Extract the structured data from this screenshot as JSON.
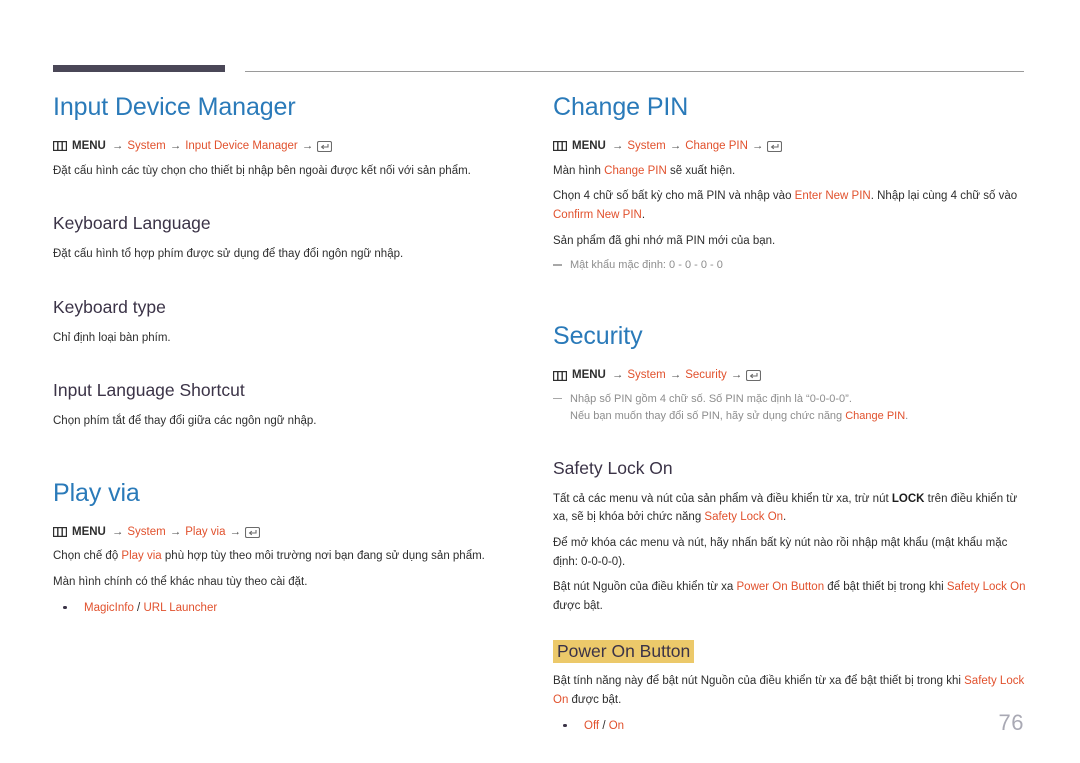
{
  "page": {
    "number": "76"
  },
  "icons": {
    "menu": "menu-grid-icon",
    "enter": "enter-key-icon"
  },
  "labels": {
    "menu_word": "MENU",
    "arrow": "→",
    "slash": " / "
  },
  "left_column": [
    {
      "type": "section",
      "title": "Input Device Manager",
      "menu_path": [
        "System",
        "Input Device Manager"
      ],
      "paragraphs": [
        "Đặt cấu hình các tùy chọn cho thiết bị nhập bên ngoài được kết nối với sản phẩm."
      ],
      "subsections": [
        {
          "title": "Keyboard Language",
          "paragraphs": [
            "Đặt cấu hình tổ hợp phím được sử dụng để thay đổi ngôn ngữ nhập."
          ]
        },
        {
          "title": "Keyboard type",
          "paragraphs": [
            "Chỉ định loại bàn phím."
          ]
        },
        {
          "title": "Input Language Shortcut",
          "paragraphs": [
            "Chọn phím tắt để thay đổi giữa các ngôn ngữ nhập."
          ]
        }
      ]
    },
    {
      "type": "section",
      "title": "Play via",
      "menu_path": [
        "System",
        "Play via"
      ],
      "paragraphs": [
        "Chọn chế độ Play via phù hợp tùy theo môi trường nơi bạn đang sử dụng sản phẩm.",
        "Màn hình chính có thể khác nhau tùy theo cài đặt."
      ],
      "bullets": [
        {
          "options": [
            "MagicInfo",
            "URL Launcher"
          ]
        }
      ]
    }
  ],
  "right_column": [
    {
      "type": "section",
      "title": "Change PIN",
      "menu_path": [
        "System",
        "Change PIN"
      ],
      "paragraphs": [
        "Màn hình Change PIN sẽ xuất hiện.",
        "Chọn 4 chữ số bất kỳ cho mã PIN và nhập vào Enter New PIN. Nhập lại cùng 4 chữ số vào Confirm New PIN.",
        "Sản phẩm đã ghi nhớ mã PIN mới của bạn."
      ],
      "notes": [
        "Mật khẩu mặc định: 0 - 0 - 0 - 0"
      ]
    },
    {
      "type": "section",
      "title": "Security",
      "menu_path": [
        "System",
        "Security"
      ],
      "notes": [
        "Nhập số PIN gồm 4 chữ số. Số PIN mặc định là “0-0-0-0”.",
        "Nếu bạn muốn thay đổi số PIN, hãy sử dụng chức năng Change PIN."
      ],
      "subsections": [
        {
          "title": "Safety Lock On",
          "paragraphs": [
            "Tất cả các menu và nút của sản phẩm và điều khiển từ xa, trừ nút LOCK trên điều khiển từ xa, sẽ bị khóa bởi chức năng Safety Lock On.",
            "Để mở khóa các menu và nút, hãy nhấn bất kỳ nút nào rồi nhập mật khẩu (mật khẩu mặc định: 0-0-0-0).",
            "Bật nút Nguồn của điều khiển từ xa Power On Button để bật thiết bị trong khi Safety Lock On được bật."
          ]
        },
        {
          "title": "Power On Button",
          "highlighted": true,
          "paragraphs": [
            "Bật tính năng này để bật nút Nguồn của điều khiển từ xa để bật thiết bị trong khi Safety Lock On được bật."
          ],
          "bullets": [
            {
              "options": [
                "Off",
                "On"
              ]
            }
          ]
        }
      ]
    }
  ],
  "text_fragments": {
    "idm_body": "Đặt cấu hình các tùy chọn cho thiết bị nhập bên ngoài được kết nối với sản phẩm.",
    "kb_lang_title": "Keyboard Language",
    "kb_lang_body": "Đặt cấu hình tổ hợp phím được sử dụng để thay đổi ngôn ngữ nhập.",
    "kb_type_title": "Keyboard type",
    "kb_type_body": "Chỉ định loại bàn phím.",
    "ils_title": "Input Language Shortcut",
    "ils_body": "Chọn phím tắt để thay đổi giữa các ngôn ngữ nhập.",
    "playvia_title": "Play via",
    "playvia_p1_a": "Chọn chế độ ",
    "playvia_p1_accent": "Play via",
    "playvia_p1_b": " phù hợp tùy theo môi trường nơi bạn đang sử dụng sản phẩm.",
    "playvia_p2": "Màn hình chính có thể khác nhau tùy theo cài đặt.",
    "playvia_opt1": "MagicInfo",
    "playvia_opt2": "URL Launcher",
    "changepin_title": "Change PIN",
    "changepin_p1_a": "Màn hình ",
    "changepin_p1_accent": "Change PIN",
    "changepin_p1_b": " sẽ xuất hiện.",
    "changepin_p2_a": "Chọn 4 chữ số bất kỳ cho mã PIN và nhập vào ",
    "changepin_p2_accent1": "Enter New PIN",
    "changepin_p2_b": ". Nhập lại cùng 4 chữ số vào ",
    "changepin_p2_accent2": "Confirm New PIN",
    "changepin_p2_c": ".",
    "changepin_p3": "Sản phẩm đã ghi nhớ mã PIN mới của bạn.",
    "changepin_note": "Mật khẩu mặc định: 0 - 0 - 0 - 0",
    "security_title": "Security",
    "security_note1": "Nhập số PIN gồm 4 chữ số. Số PIN mặc định là “0-0-0-0”.",
    "security_note2_a": "Nếu bạn muốn thay đổi số PIN, hãy sử dụng chức năng ",
    "security_note2_accent": "Change PIN",
    "security_note2_b": ".",
    "safety_title": "Safety Lock On",
    "safety_p1_a": "Tất cả các menu và nút của sản phẩm và điều khiển từ xa, trừ nút ",
    "safety_p1_bold": "LOCK",
    "safety_p1_b": " trên điều khiển từ xa, sẽ bị khóa bởi chức năng ",
    "safety_p1_accent": "Safety Lock On",
    "safety_p1_c": ".",
    "safety_p2": "Để mở khóa các menu và nút, hãy nhấn bất kỳ nút nào rồi nhập mật khẩu (mật khẩu mặc định: 0-0-0-0).",
    "safety_p3_a": "Bật nút Nguồn của điều khiển từ xa ",
    "safety_p3_accent1": "Power On Button",
    "safety_p3_b": " để bật thiết bị trong khi ",
    "safety_p3_accent2": "Safety Lock On",
    "safety_p3_c": " được bật.",
    "pob_title": "Power On Button",
    "pob_p1_a": "Bật tính năng này để bật nút Nguồn của điều khiển từ xa để bật thiết bị trong khi ",
    "pob_p1_accent": "Safety Lock On",
    "pob_p1_b": " được bật.",
    "pob_opt1": "Off",
    "pob_opt2": "On",
    "idm_title": "Input Device Manager",
    "crumb_system": "System",
    "crumb_idm": "Input Device Manager",
    "crumb_playvia": "Play via",
    "crumb_changepin": "Change PIN",
    "crumb_security": "Security"
  },
  "colors": {
    "heading_blue": "#2a7ab9",
    "accent_orange": "#e1512d",
    "sub_heading": "#3b3347",
    "highlight_yellow": "#ecc96a",
    "rule_dark": "#4a4757",
    "page_number": "#a9a9b4"
  }
}
